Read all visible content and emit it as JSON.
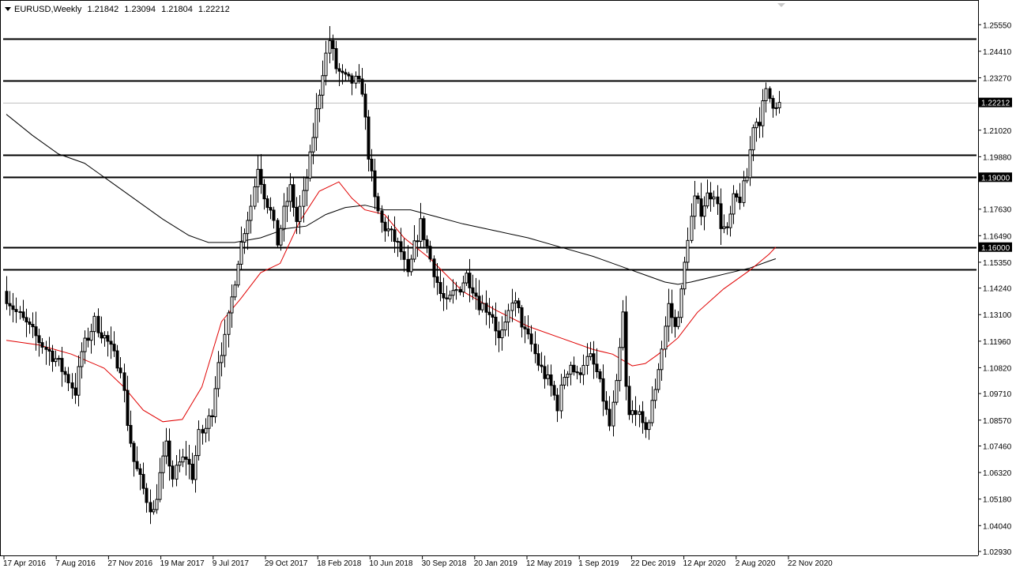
{
  "header": {
    "symbol": "EURUSD,Weekly",
    "open": "1.21842",
    "high": "1.23094",
    "low": "1.21804",
    "close": "1.22212"
  },
  "colors": {
    "background": "#ffffff",
    "bull_body": "#ffffff",
    "bear_body": "#000000",
    "candle_outline": "#000000",
    "ma_fast": "#e00000",
    "ma_slow": "#000000",
    "level_line": "#000000",
    "last_price_line": "#c0c0c0"
  },
  "chart_data": {
    "type": "candlestick",
    "title": "EURUSD,Weekly",
    "ylim": [
      1.0293,
      1.26
    ],
    "y_ticks": [
      "1.25550",
      "1.24410",
      "1.23270",
      "1.22212",
      "1.21020",
      "1.19880",
      "1.19000",
      "1.17630",
      "1.16490",
      "1.16000",
      "1.15350",
      "1.14240",
      "1.13100",
      "1.11960",
      "1.10820",
      "1.09710",
      "1.08570",
      "1.07460",
      "1.06320",
      "1.05180",
      "1.04040",
      "1.02930"
    ],
    "x_ticks": [
      "17 Apr 2016",
      "7 Aug 2016",
      "27 Nov 2016",
      "19 Mar 2017",
      "9 Jul 2017",
      "29 Oct 2017",
      "18 Feb 2018",
      "10 Jun 2018",
      "30 Sep 2018",
      "20 Jan 2019",
      "12 May 2019",
      "1 Sep 2019",
      "22 Dec 2019",
      "12 Apr 2020",
      "2 Aug 2020",
      "22 Nov 2020"
    ],
    "last_price": 1.22212,
    "horizontal_levels": [
      1.2495,
      1.2315,
      1.1995,
      1.19,
      1.16,
      1.1505
    ],
    "labeled_levels": [
      {
        "value": 1.19,
        "label": "1.19000"
      },
      {
        "value": 1.16,
        "label": "1.16000"
      }
    ],
    "price_path": [
      [
        0,
        1.141
      ],
      [
        4,
        1.132
      ],
      [
        8,
        1.125
      ],
      [
        12,
        1.118
      ],
      [
        16,
        1.112
      ],
      [
        20,
        1.103
      ],
      [
        22,
        1.098
      ],
      [
        24,
        1.115
      ],
      [
        28,
        1.128
      ],
      [
        32,
        1.119
      ],
      [
        34,
        1.113
      ],
      [
        36,
        1.109
      ],
      [
        38,
        1.085
      ],
      [
        40,
        1.068
      ],
      [
        42,
        1.06
      ],
      [
        44,
        1.052
      ],
      [
        46,
        1.046
      ],
      [
        48,
        1.062
      ],
      [
        50,
        1.074
      ],
      [
        52,
        1.061
      ],
      [
        54,
        1.067
      ],
      [
        56,
        1.07
      ],
      [
        58,
        1.062
      ],
      [
        60,
        1.079
      ],
      [
        62,
        1.082
      ],
      [
        64,
        1.09
      ],
      [
        66,
        1.112
      ],
      [
        68,
        1.12
      ],
      [
        70,
        1.138
      ],
      [
        72,
        1.155
      ],
      [
        74,
        1.168
      ],
      [
        76,
        1.178
      ],
      [
        78,
        1.195
      ],
      [
        80,
        1.183
      ],
      [
        82,
        1.175
      ],
      [
        84,
        1.162
      ],
      [
        86,
        1.175
      ],
      [
        88,
        1.185
      ],
      [
        90,
        1.171
      ],
      [
        92,
        1.182
      ],
      [
        94,
        1.198
      ],
      [
        96,
        1.218
      ],
      [
        98,
        1.236
      ],
      [
        100,
        1.249
      ],
      [
        102,
        1.237
      ],
      [
        104,
        1.233
      ],
      [
        106,
        1.231
      ],
      [
        108,
        1.231
      ],
      [
        110,
        1.228
      ],
      [
        112,
        1.2
      ],
      [
        114,
        1.18
      ],
      [
        116,
        1.17
      ],
      [
        118,
        1.167
      ],
      [
        120,
        1.163
      ],
      [
        122,
        1.158
      ],
      [
        124,
        1.147
      ],
      [
        126,
        1.16
      ],
      [
        128,
        1.17
      ],
      [
        130,
        1.16
      ],
      [
        132,
        1.15
      ],
      [
        134,
        1.14
      ],
      [
        136,
        1.135
      ],
      [
        138,
        1.14
      ],
      [
        140,
        1.143
      ],
      [
        142,
        1.148
      ],
      [
        144,
        1.143
      ],
      [
        146,
        1.136
      ],
      [
        148,
        1.134
      ],
      [
        150,
        1.131
      ],
      [
        152,
        1.12
      ],
      [
        154,
        1.125
      ],
      [
        156,
        1.138
      ],
      [
        158,
        1.132
      ],
      [
        160,
        1.123
      ],
      [
        162,
        1.118
      ],
      [
        164,
        1.11
      ],
      [
        166,
        1.105
      ],
      [
        168,
        1.1
      ],
      [
        170,
        1.092
      ],
      [
        172,
        1.105
      ],
      [
        174,
        1.11
      ],
      [
        176,
        1.104
      ],
      [
        178,
        1.111
      ],
      [
        180,
        1.112
      ],
      [
        182,
        1.106
      ],
      [
        184,
        1.095
      ],
      [
        186,
        1.083
      ],
      [
        188,
        1.1
      ],
      [
        190,
        1.131
      ],
      [
        191,
        1.099
      ],
      [
        192,
        1.087
      ],
      [
        194,
        1.091
      ],
      [
        196,
        1.082
      ],
      [
        198,
        1.085
      ],
      [
        200,
        1.1
      ],
      [
        202,
        1.117
      ],
      [
        204,
        1.135
      ],
      [
        206,
        1.125
      ],
      [
        208,
        1.14
      ],
      [
        210,
        1.165
      ],
      [
        212,
        1.18
      ],
      [
        214,
        1.176
      ],
      [
        216,
        1.182
      ],
      [
        218,
        1.184
      ],
      [
        220,
        1.17
      ],
      [
        222,
        1.166
      ],
      [
        224,
        1.18
      ],
      [
        226,
        1.181
      ],
      [
        228,
        1.19
      ],
      [
        230,
        1.213
      ],
      [
        232,
        1.215
      ],
      [
        234,
        1.226
      ],
      [
        236,
        1.2221
      ]
    ],
    "ma_fast_path": [
      [
        0,
        1.12
      ],
      [
        10,
        1.118
      ],
      [
        20,
        1.114
      ],
      [
        30,
        1.108
      ],
      [
        36,
        1.1
      ],
      [
        42,
        1.09
      ],
      [
        48,
        1.085
      ],
      [
        54,
        1.086
      ],
      [
        60,
        1.1
      ],
      [
        66,
        1.128
      ],
      [
        72,
        1.138
      ],
      [
        78,
        1.149
      ],
      [
        84,
        1.153
      ],
      [
        90,
        1.171
      ],
      [
        96,
        1.184
      ],
      [
        102,
        1.188
      ],
      [
        106,
        1.181
      ],
      [
        110,
        1.176
      ],
      [
        116,
        1.174
      ],
      [
        122,
        1.164
      ],
      [
        130,
        1.155
      ],
      [
        140,
        1.141
      ],
      [
        150,
        1.133
      ],
      [
        160,
        1.126
      ],
      [
        170,
        1.121
      ],
      [
        180,
        1.116
      ],
      [
        186,
        1.114
      ],
      [
        192,
        1.109
      ],
      [
        196,
        1.11
      ],
      [
        200,
        1.114
      ],
      [
        206,
        1.121
      ],
      [
        212,
        1.132
      ],
      [
        220,
        1.142
      ],
      [
        228,
        1.15
      ],
      [
        234,
        1.157
      ],
      [
        236,
        1.16
      ]
    ],
    "ma_slow_path": [
      [
        0,
        1.217
      ],
      [
        8,
        1.208
      ],
      [
        16,
        1.2
      ],
      [
        24,
        1.196
      ],
      [
        32,
        1.188
      ],
      [
        40,
        1.18
      ],
      [
        48,
        1.172
      ],
      [
        56,
        1.165
      ],
      [
        62,
        1.162
      ],
      [
        70,
        1.162
      ],
      [
        78,
        1.164
      ],
      [
        86,
        1.168
      ],
      [
        92,
        1.169
      ],
      [
        98,
        1.174
      ],
      [
        104,
        1.177
      ],
      [
        110,
        1.178
      ],
      [
        116,
        1.176
      ],
      [
        124,
        1.176
      ],
      [
        132,
        1.173
      ],
      [
        140,
        1.17
      ],
      [
        150,
        1.167
      ],
      [
        160,
        1.164
      ],
      [
        170,
        1.16
      ],
      [
        180,
        1.156
      ],
      [
        190,
        1.151
      ],
      [
        196,
        1.148
      ],
      [
        202,
        1.145
      ],
      [
        206,
        1.144
      ],
      [
        210,
        1.145
      ],
      [
        216,
        1.147
      ],
      [
        222,
        1.149
      ],
      [
        228,
        1.151
      ],
      [
        234,
        1.154
      ],
      [
        236,
        1.155
      ]
    ]
  }
}
